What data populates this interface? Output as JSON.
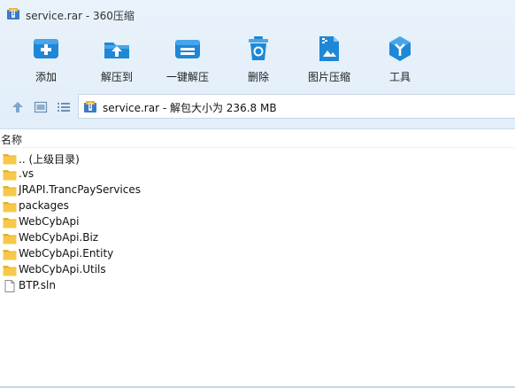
{
  "window": {
    "title": "service.rar - 360压缩"
  },
  "toolbar": {
    "items": [
      {
        "label": "添加",
        "icon": "add-icon"
      },
      {
        "label": "解压到",
        "icon": "extract-to-icon"
      },
      {
        "label": "一键解压",
        "icon": "one-click-extract-icon"
      },
      {
        "label": "删除",
        "icon": "delete-icon"
      },
      {
        "label": "图片压缩",
        "icon": "image-compress-icon"
      },
      {
        "label": "工具",
        "icon": "tools-icon"
      }
    ]
  },
  "nav": {
    "address": "service.rar - 解包大小为 236.8 MB",
    "buttons": [
      "up-arrow-icon",
      "view-icon",
      "list-view-icon"
    ]
  },
  "list": {
    "column_name": "名称",
    "items": [
      {
        "name": ".. (上级目录)",
        "type": "folder"
      },
      {
        "name": ".vs",
        "type": "folder"
      },
      {
        "name": "JRAPI.TrancPayServices",
        "type": "folder"
      },
      {
        "name": "packages",
        "type": "folder"
      },
      {
        "name": "WebCybApi",
        "type": "folder"
      },
      {
        "name": "WebCybApi.Biz",
        "type": "folder"
      },
      {
        "name": "WebCybApi.Entity",
        "type": "folder"
      },
      {
        "name": "WebCybApi.Utils",
        "type": "folder"
      },
      {
        "name": "BTP.sln",
        "type": "file"
      }
    ]
  },
  "colors": {
    "accent": "#1e88d6",
    "folder": "#f5c445",
    "toolbar_bg": "#e6f0fa"
  }
}
